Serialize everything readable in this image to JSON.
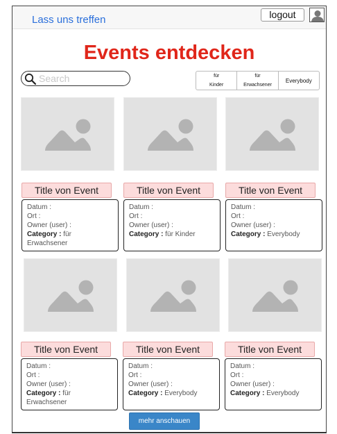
{
  "header": {
    "brand": "Lass uns treffen",
    "logout_label": "logout",
    "user_icon": "user-icon"
  },
  "page": {
    "title": "Events entdecken"
  },
  "search": {
    "placeholder": "Search",
    "value": ""
  },
  "filters": [
    {
      "label": "für\nKinder"
    },
    {
      "label": "für\nErwachsener"
    },
    {
      "label": "Everybody"
    }
  ],
  "field_labels": {
    "date": "Datum :",
    "place": "Ort :",
    "owner": "Owner (user) :",
    "category": "Category :"
  },
  "events": [
    {
      "title": "Title von Event",
      "category": "für Erwachsener"
    },
    {
      "title": "Title von Event",
      "category": "für Kinder"
    },
    {
      "title": "Title von Event",
      "category": "Everybody"
    },
    {
      "title": "Title von Event",
      "category": "für Erwachsener"
    },
    {
      "title": "Title von Event",
      "category": "Everybody"
    },
    {
      "title": "Title von Event",
      "category": "Everybody"
    }
  ],
  "more_button_label": "mehr anschauen",
  "colors": {
    "title_red": "#e0261a",
    "brand_blue": "#2a6fdb",
    "title_bg": "#fcdcdc",
    "button_blue": "#3a86c8",
    "image_placeholder": "#e2e2e2"
  }
}
